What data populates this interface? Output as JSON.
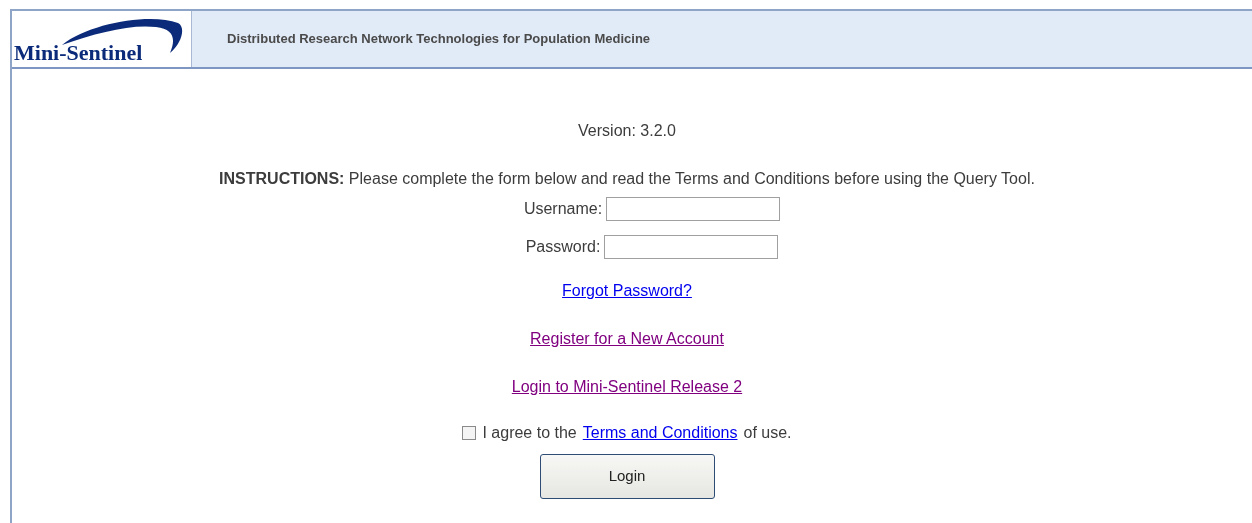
{
  "header": {
    "logo": "Mini-Sentinel",
    "tagline": "Distributed Research Network Technologies for Population Medicine"
  },
  "version": "Version: 3.2.0",
  "instructions": "**INSTRUCTIONS:** Please complete the form below and read the Terms and Conditions before using the Query Tool.",
  "fields": [
    {
      "label": "Username:"
    },
    {
      "label": "Password:"
    }
  ],
  "links": [
    {
      "text": "Forgot Password?",
      "visited": false
    },
    {
      "text": "Register for a New Account",
      "visited": true
    },
    {
      "text": "Login to Mini-Sentinel Release 2",
      "visited": true
    }
  ],
  "agreement": {
    "checked": false,
    "before": "I agree to the",
    "link": "Terms and Conditions",
    "after": "of use."
  },
  "login_button": "Login"
}
